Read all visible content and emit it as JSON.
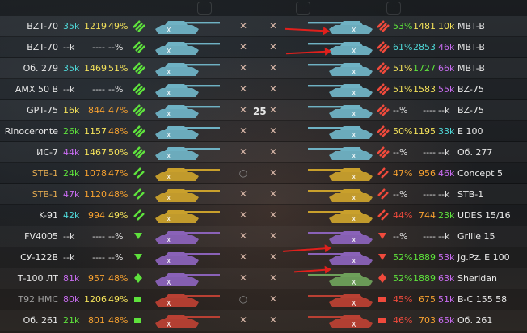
{
  "colors": {
    "green": "#5ee23c",
    "teal": "#4fd8d8",
    "yellow": "#f3e15a",
    "orange": "#f5a030",
    "purple": "#c86cf0",
    "red": "#f04a3c",
    "dash": "#e0e0e0",
    "name_alive": "#e8e8e8",
    "name_artillery": "#9a9a9a",
    "name_light": "#e0a850"
  },
  "center_count": "25",
  "left_team": [
    {
      "name": "BZT-70",
      "games": "35k",
      "games_c": "teal",
      "battles": "1219",
      "battles_c": "yellow",
      "wr": "49%",
      "wr_c": "yellow",
      "cls": "heavy",
      "tank_color": "#6fb2c4",
      "status": "dead",
      "name_c": "name_alive"
    },
    {
      "name": "BZT-70",
      "games": "--k",
      "games_c": "dash",
      "battles": "----",
      "battles_c": "dash",
      "wr": "--%",
      "wr_c": "dash",
      "cls": "heavy",
      "tank_color": "#6fb2c4",
      "status": "dead",
      "name_c": "name_alive"
    },
    {
      "name": "Об. 279",
      "games": "35k",
      "games_c": "teal",
      "battles": "1469",
      "battles_c": "yellow",
      "wr": "51%",
      "wr_c": "yellow",
      "cls": "heavy",
      "tank_color": "#6fb2c4",
      "status": "dead",
      "name_c": "name_alive"
    },
    {
      "name": "AMX 50 B",
      "games": "--k",
      "games_c": "dash",
      "battles": "----",
      "battles_c": "dash",
      "wr": "--%",
      "wr_c": "dash",
      "cls": "heavy",
      "tank_color": "#6fb2c4",
      "status": "dead",
      "name_c": "name_alive"
    },
    {
      "name": "GPT-75",
      "games": "16k",
      "games_c": "yellow",
      "battles": "844",
      "battles_c": "orange",
      "wr": "47%",
      "wr_c": "orange",
      "cls": "heavy",
      "tank_color": "#6fb2c4",
      "status": "dead",
      "name_c": "name_alive"
    },
    {
      "name": "Rinoceronte",
      "games": "26k",
      "games_c": "green",
      "battles": "1157",
      "battles_c": "yellow",
      "wr": "48%",
      "wr_c": "orange",
      "cls": "heavy",
      "tank_color": "#6fb2c4",
      "status": "dead",
      "name_c": "name_alive"
    },
    {
      "name": "ИС-7",
      "games": "44k",
      "games_c": "purple",
      "battles": "1467",
      "battles_c": "yellow",
      "wr": "50%",
      "wr_c": "yellow",
      "cls": "heavy",
      "tank_color": "#6fb2c4",
      "status": "dead",
      "name_c": "name_alive"
    },
    {
      "name": "STB-1",
      "games": "24k",
      "games_c": "green",
      "battles": "1078",
      "battles_c": "orange",
      "wr": "47%",
      "wr_c": "orange",
      "cls": "medium",
      "tank_color": "#c9a02c",
      "status": "alive",
      "name_c": "name_light"
    },
    {
      "name": "STB-1",
      "games": "47k",
      "games_c": "purple",
      "battles": "1120",
      "battles_c": "orange",
      "wr": "48%",
      "wr_c": "orange",
      "cls": "medium",
      "tank_color": "#c9a02c",
      "status": "dead",
      "name_c": "name_light"
    },
    {
      "name": "K-91",
      "games": "42k",
      "games_c": "teal",
      "battles": "994",
      "battles_c": "orange",
      "wr": "49%",
      "wr_c": "yellow",
      "cls": "medium",
      "tank_color": "#c9a02c",
      "status": "dead",
      "name_c": "name_alive"
    },
    {
      "name": "FV4005",
      "games": "--k",
      "games_c": "dash",
      "battles": "----",
      "battles_c": "dash",
      "wr": "--%",
      "wr_c": "dash",
      "cls": "td",
      "tank_color": "#8a62b8",
      "status": "dead",
      "name_c": "name_alive"
    },
    {
      "name": "СУ-122В",
      "games": "--k",
      "games_c": "dash",
      "battles": "----",
      "battles_c": "dash",
      "wr": "--%",
      "wr_c": "dash",
      "cls": "td",
      "tank_color": "#8a62b8",
      "status": "dead",
      "name_c": "name_alive"
    },
    {
      "name": "Т-100 ЛТ",
      "games": "81k",
      "games_c": "purple",
      "battles": "957",
      "battles_c": "orange",
      "wr": "48%",
      "wr_c": "orange",
      "cls": "light",
      "tank_color": "#8a62b8",
      "status": "dead",
      "name_c": "name_alive"
    },
    {
      "name": "T92 HMC",
      "games": "80k",
      "games_c": "purple",
      "battles": "1206",
      "battles_c": "yellow",
      "wr": "49%",
      "wr_c": "yellow",
      "cls": "spg",
      "tank_color": "#b94033",
      "status": "alive",
      "name_c": "name_artillery"
    },
    {
      "name": "Об. 261",
      "games": "21k",
      "games_c": "green",
      "battles": "801",
      "battles_c": "orange",
      "wr": "48%",
      "wr_c": "orange",
      "cls": "spg",
      "tank_color": "#b94033",
      "status": "dead",
      "name_c": "name_alive"
    }
  ],
  "right_team": [
    {
      "name": "MBT-B",
      "games": "10k",
      "games_c": "yellow",
      "battles": "1481",
      "battles_c": "yellow",
      "wr": "53%",
      "wr_c": "green",
      "cls": "heavy",
      "tank_color": "#6fb2c4",
      "status": "dead"
    },
    {
      "name": "MBT-B",
      "games": "46k",
      "games_c": "purple",
      "battles": "2853",
      "battles_c": "teal",
      "wr": "61%",
      "wr_c": "teal",
      "cls": "heavy",
      "tank_color": "#6fb2c4",
      "status": "dead"
    },
    {
      "name": "MBT-B",
      "games": "66k",
      "games_c": "purple",
      "battles": "1727",
      "battles_c": "green",
      "wr": "51%",
      "wr_c": "yellow",
      "cls": "heavy",
      "tank_color": "#6fb2c4",
      "status": "dead"
    },
    {
      "name": "BZ-75",
      "games": "55k",
      "games_c": "purple",
      "battles": "1583",
      "battles_c": "yellow",
      "wr": "51%",
      "wr_c": "yellow",
      "cls": "heavy",
      "tank_color": "#6fb2c4",
      "status": "dead"
    },
    {
      "name": "BZ-75",
      "games": "--k",
      "games_c": "dash",
      "battles": "----",
      "battles_c": "dash",
      "wr": "--%",
      "wr_c": "dash",
      "cls": "heavy",
      "tank_color": "#6fb2c4",
      "status": "dead"
    },
    {
      "name": "E 100",
      "games": "33k",
      "games_c": "teal",
      "battles": "1195",
      "battles_c": "yellow",
      "wr": "50%",
      "wr_c": "yellow",
      "cls": "heavy",
      "tank_color": "#6fb2c4",
      "status": "dead"
    },
    {
      "name": "Об. 277",
      "games": "--k",
      "games_c": "dash",
      "battles": "----",
      "battles_c": "dash",
      "wr": "--%",
      "wr_c": "dash",
      "cls": "heavy",
      "tank_color": "#6fb2c4",
      "status": "dead"
    },
    {
      "name": "Concept 5",
      "games": "46k",
      "games_c": "purple",
      "battles": "956",
      "battles_c": "orange",
      "wr": "47%",
      "wr_c": "orange",
      "cls": "medium",
      "tank_color": "#c9a02c",
      "status": "dead"
    },
    {
      "name": "STB-1",
      "games": "--k",
      "games_c": "dash",
      "battles": "----",
      "battles_c": "dash",
      "wr": "--%",
      "wr_c": "dash",
      "cls": "medium",
      "tank_color": "#c9a02c",
      "status": "dead"
    },
    {
      "name": "UDES 15/16",
      "games": "23k",
      "games_c": "green",
      "battles": "744",
      "battles_c": "orange",
      "wr": "44%",
      "wr_c": "red",
      "cls": "medium",
      "tank_color": "#c9a02c",
      "status": "dead"
    },
    {
      "name": "Grille 15",
      "games": "--k",
      "games_c": "dash",
      "battles": "----",
      "battles_c": "dash",
      "wr": "--%",
      "wr_c": "dash",
      "cls": "td",
      "tank_color": "#8a62b8",
      "status": "dead"
    },
    {
      "name": "Jg.Pz. E 100",
      "games": "53k",
      "games_c": "purple",
      "battles": "1889",
      "battles_c": "green",
      "wr": "52%",
      "wr_c": "green",
      "cls": "td",
      "tank_color": "#8a62b8",
      "status": "dead"
    },
    {
      "name": "Sheridan",
      "games": "63k",
      "games_c": "purple",
      "battles": "1889",
      "battles_c": "green",
      "wr": "52%",
      "wr_c": "green",
      "cls": "light",
      "tank_color": "#6ea05a",
      "status": "dead"
    },
    {
      "name": "B-C 155 58",
      "games": "51k",
      "games_c": "purple",
      "battles": "675",
      "battles_c": "orange",
      "wr": "45%",
      "wr_c": "red",
      "cls": "spg",
      "tank_color": "#b94033",
      "status": "dead"
    },
    {
      "name": "Об. 261",
      "games": "65k",
      "games_c": "purple",
      "battles": "703",
      "battles_c": "orange",
      "wr": "46%",
      "wr_c": "red",
      "cls": "spg",
      "tank_color": "#b94033",
      "status": "dead"
    }
  ]
}
